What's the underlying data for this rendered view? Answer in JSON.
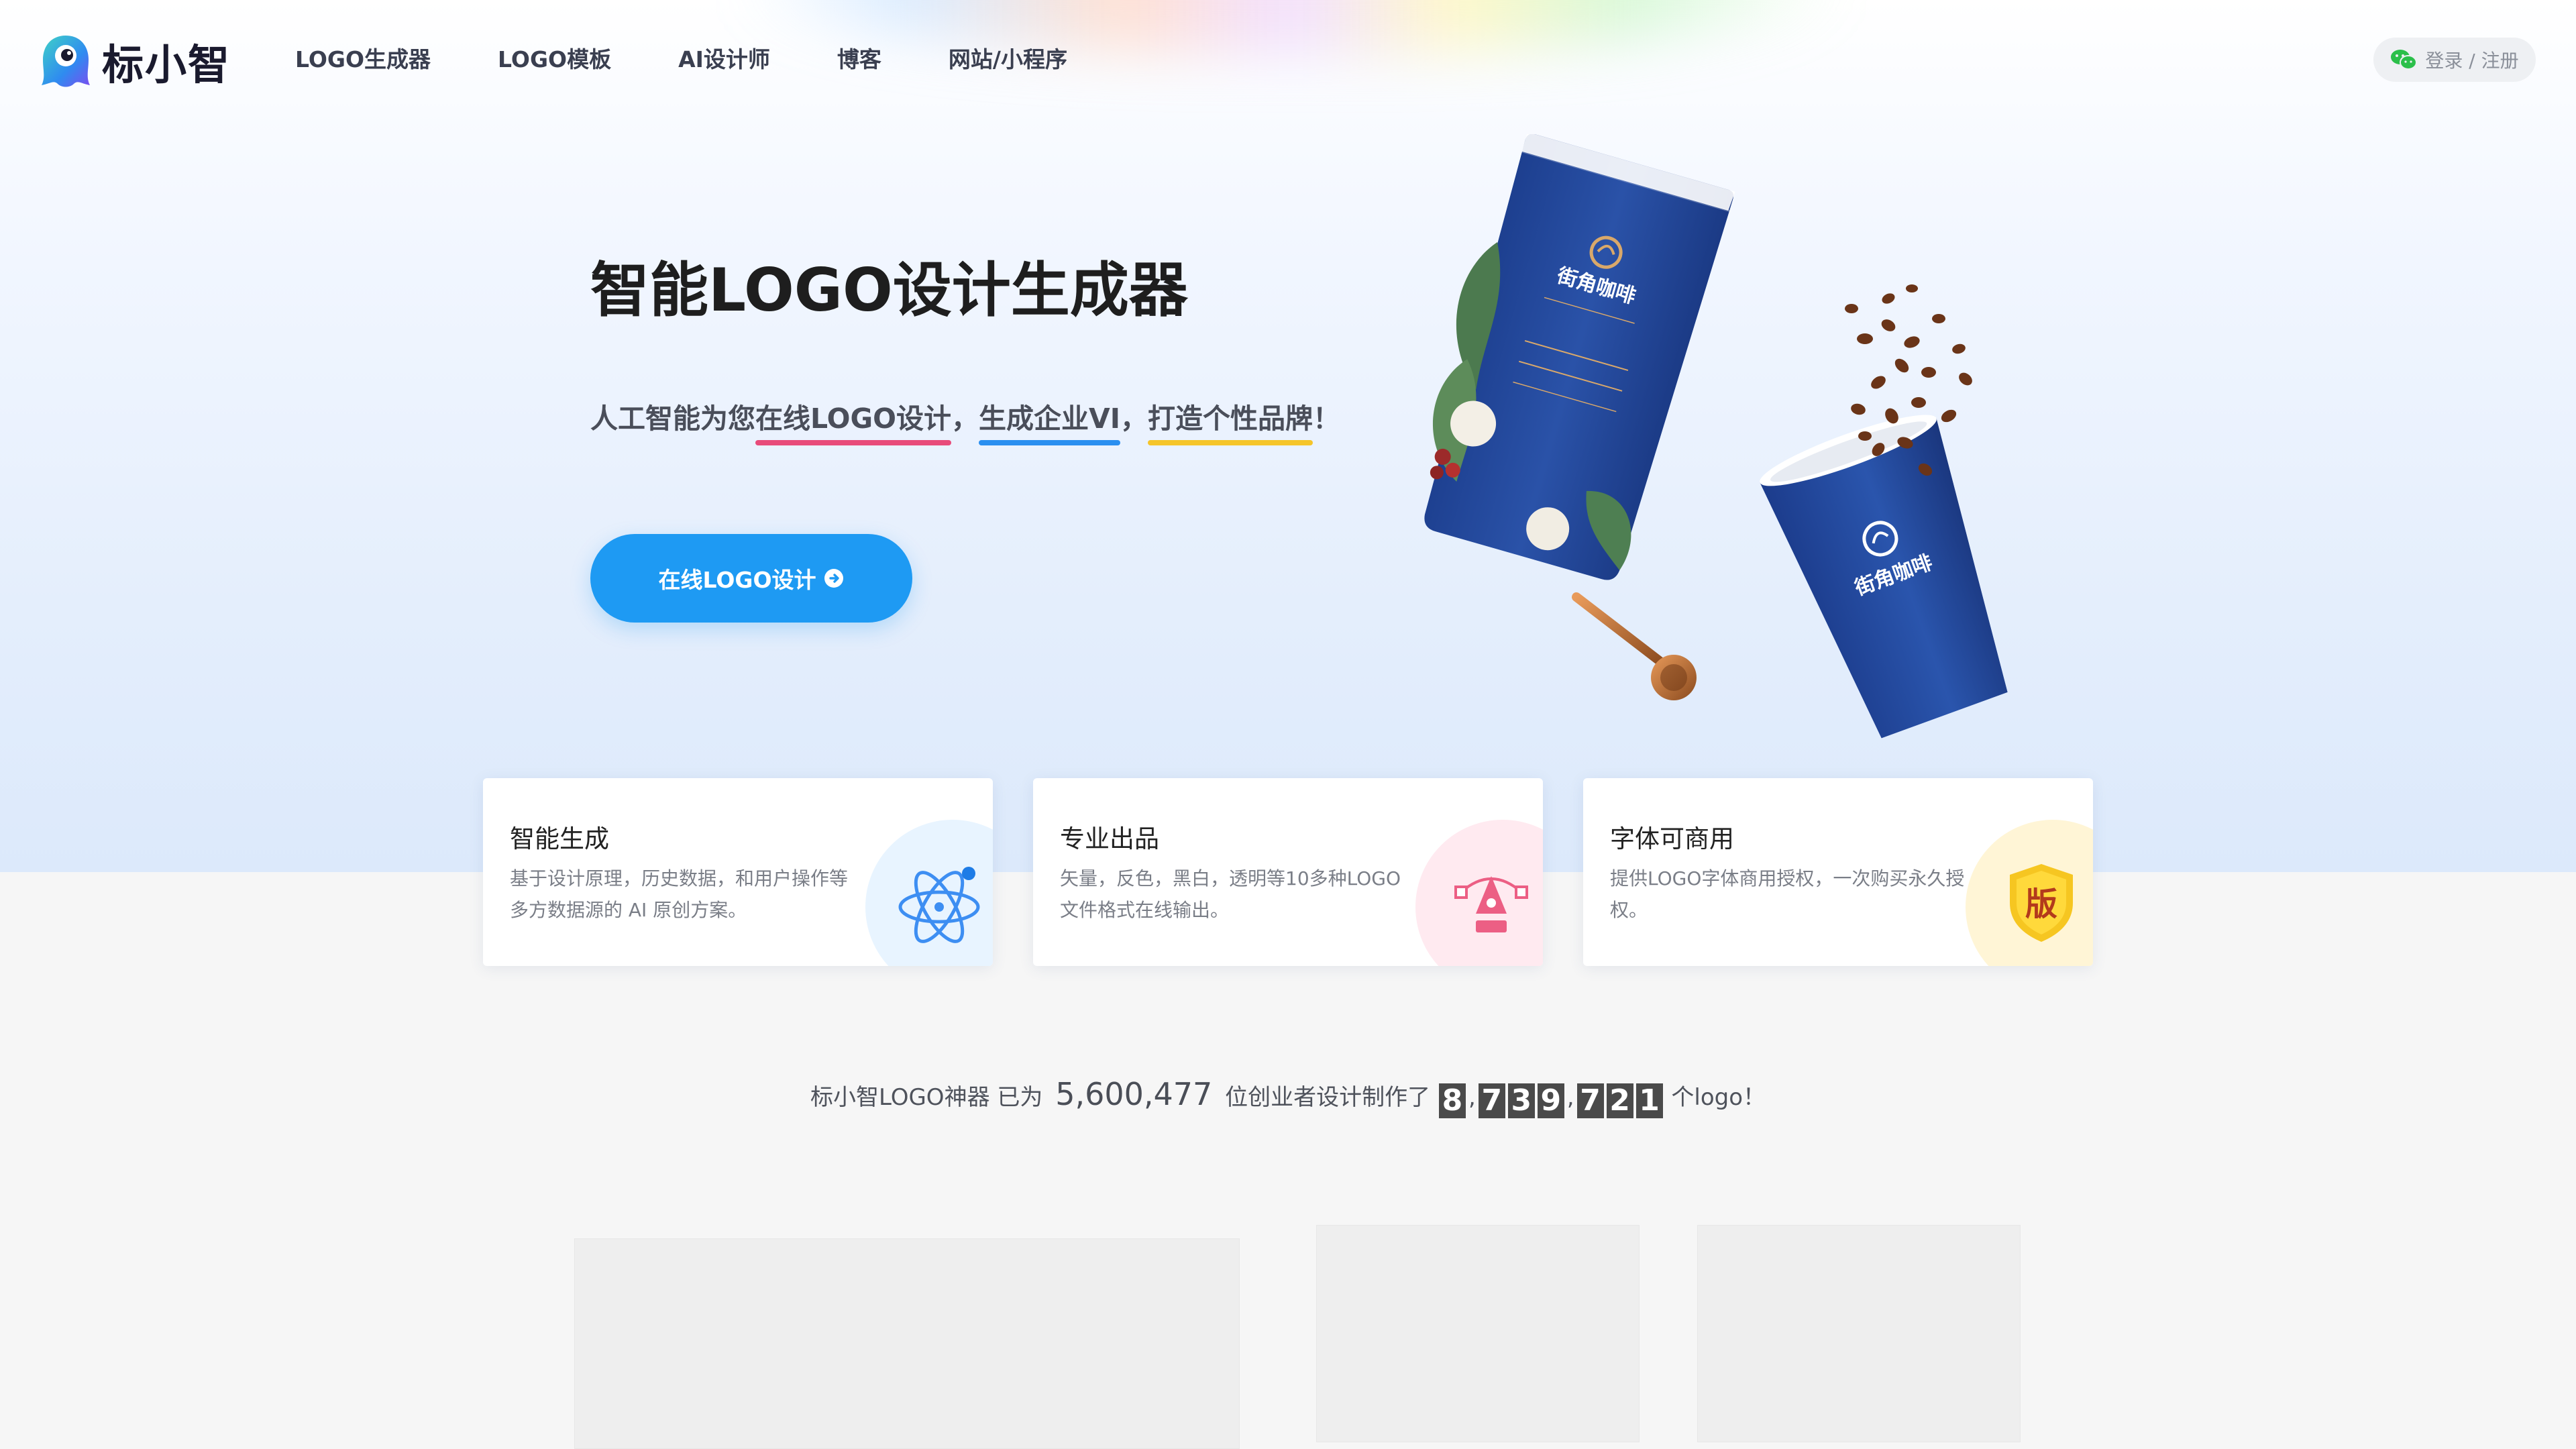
{
  "brand": {
    "name": "标小智"
  },
  "nav": {
    "items": [
      {
        "label": "LOGO生成器"
      },
      {
        "label": "LOGO模板"
      },
      {
        "label": "AI设计师"
      },
      {
        "label": "博客"
      },
      {
        "label": "网站/小程序"
      }
    ]
  },
  "login": {
    "label": "登录 / 注册"
  },
  "hero": {
    "title": "智能LOGO设计生成器",
    "subtitle": {
      "p1": "人工智能为您",
      "h1": "在线LOGO设计",
      "p2": "，",
      "h2": "生成企业VI",
      "p3": "，",
      "h3": "打造个性品牌",
      "p4": "！"
    },
    "cta_label": "在线LOGO设计"
  },
  "mockup": {
    "bag_brand": "街角咖啡",
    "cup_brand": "街角咖啡"
  },
  "features": [
    {
      "title": "智能生成",
      "desc": "基于设计原理，历史数据，和用户操作等多方数据源的 AI 原创方案。"
    },
    {
      "title": "专业出品",
      "desc": "矢量，反色，黑白，透明等10多种LOGO文件格式在线输出。"
    },
    {
      "title": "字体可商用",
      "desc": "提供LOGO字体商用授权，一次购买永久授权。",
      "badge": "版"
    }
  ],
  "stats": {
    "prefix": "标小智LOGO神器 已为",
    "users": "5,600,477",
    "middle": "位创业者设计制作了",
    "logo_count_groups": [
      "8",
      "739",
      "721"
    ],
    "suffix": "个logo！"
  },
  "colors": {
    "accent": "#1e9af3",
    "underline_pink": "#e84b7a",
    "underline_blue": "#2a8ff0",
    "underline_yellow": "#f5c52a",
    "product_blue": "#22479a"
  }
}
